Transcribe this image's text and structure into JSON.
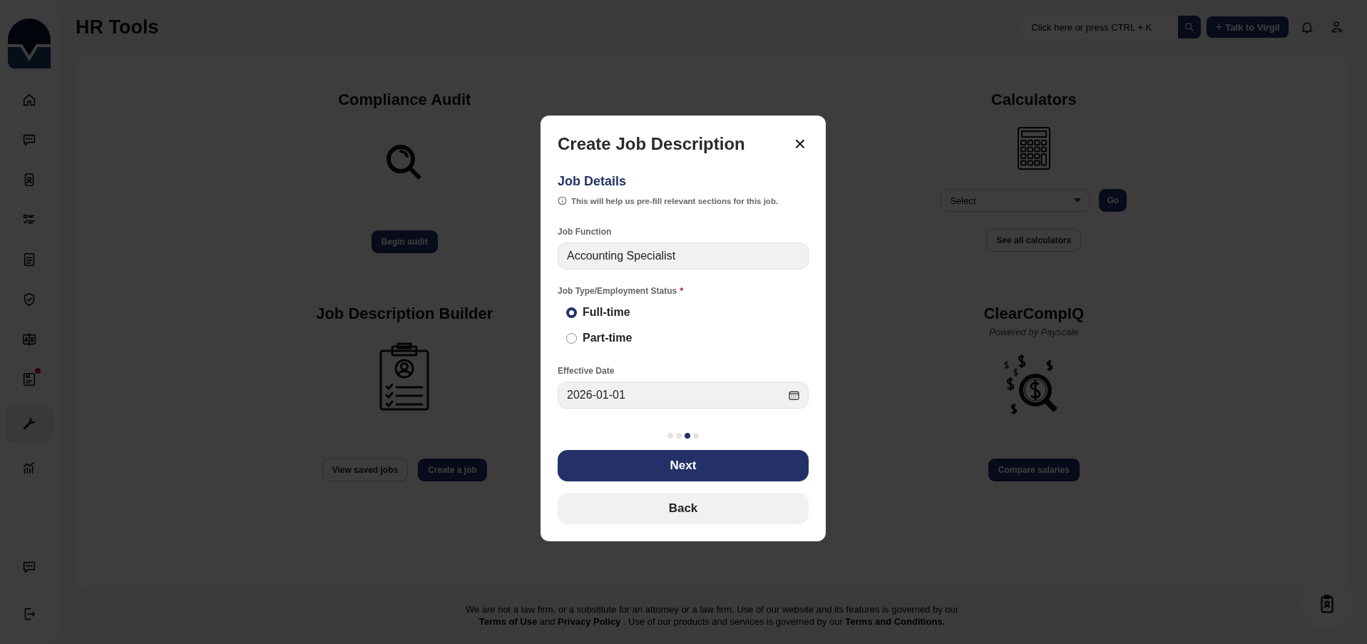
{
  "header": {
    "title": "HR Tools",
    "search": {
      "placeholder": "Click here or press CTRL + K"
    },
    "talk_button": {
      "icon": "+",
      "label": "Talk to Virgil"
    }
  },
  "sidebar": {
    "items": [
      {
        "selected": false,
        "alert": false
      },
      {
        "selected": false,
        "alert": false
      },
      {
        "selected": false,
        "alert": false
      },
      {
        "selected": false,
        "alert": false
      },
      {
        "selected": false,
        "alert": false
      },
      {
        "selected": false,
        "alert": false
      },
      {
        "selected": false,
        "alert": false
      },
      {
        "selected": false,
        "alert": true
      },
      {
        "selected": true,
        "alert": false
      },
      {
        "selected": false,
        "alert": false
      }
    ],
    "bottom_items": [
      {
        "selected": false
      },
      {
        "selected": false
      }
    ]
  },
  "tools": [
    {
      "kind": "audit",
      "title": "Compliance Audit",
      "buttons": [
        "Begin audit"
      ]
    },
    {
      "kind": "calculators",
      "title": "Calculators",
      "select": {
        "placeholder": "Select",
        "button": "Go"
      },
      "buttons": [
        "See all calculators"
      ]
    },
    {
      "kind": "job",
      "title": "Job Description Builder",
      "buttons": [
        "View saved jobs",
        "Create a job"
      ]
    },
    {
      "kind": "comp",
      "title": "ClearCompIQ",
      "subtitle": "Powered by Payscale",
      "buttons": [
        "Compare salaries"
      ]
    }
  ],
  "modal": {
    "title": "Create Job Description",
    "close": "×",
    "section": "Job Details",
    "hint": "This will help us pre-fill relevant sections for this job.",
    "job_function": {
      "label": "Job Function",
      "value": "Accounting Specialist"
    },
    "job_type": {
      "label": "Job Type/Employment Status",
      "required_mark": "*",
      "options": [
        {
          "label": "Full-time",
          "selected": true
        },
        {
          "label": "Part-time",
          "selected": false
        }
      ]
    },
    "effective_date": {
      "label": "Effective Date",
      "value": "2026-01-01"
    },
    "steps": [
      {
        "selected": false
      },
      {
        "selected": false
      },
      {
        "selected": true
      },
      {
        "selected": false
      }
    ],
    "next": "Next",
    "back": "Back"
  },
  "footer": {
    "line1": "We are not a law firm, or a substitute for an attorney or a law firm. Use of our website and its features is governed by our",
    "line2": "**Terms of Use** and **Privacy Policy** . Use of our products and services is governed by our **Terms and Conditions.**"
  }
}
